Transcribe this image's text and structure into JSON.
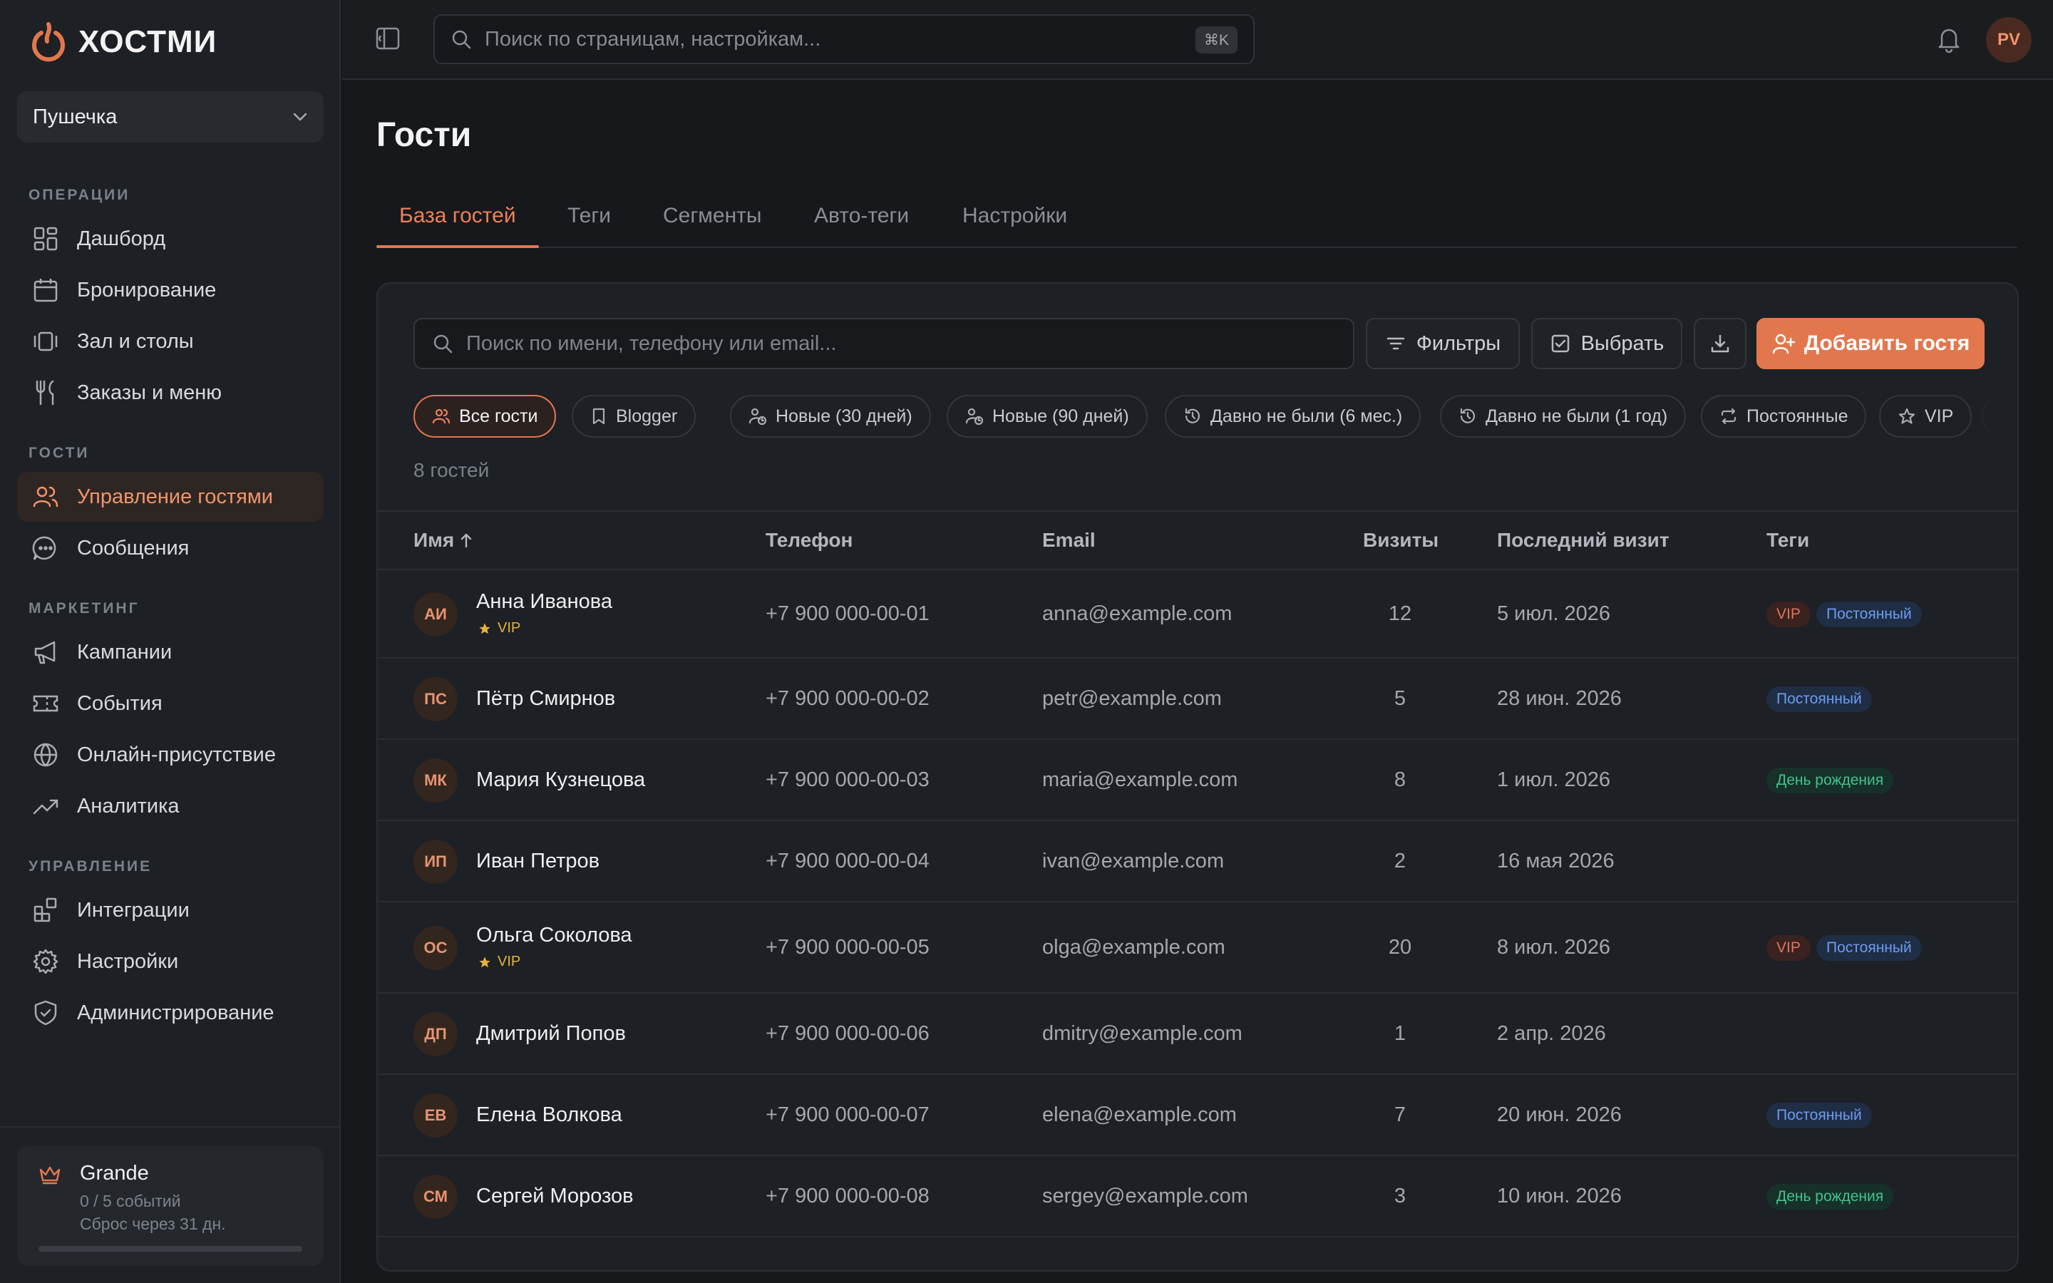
{
  "brand": {
    "logo_text": "ХОСТМИ",
    "accent": "#e2774e"
  },
  "venue": {
    "name": "Пушечка"
  },
  "sidebar": {
    "sections": [
      {
        "title": "ОПЕРАЦИИ",
        "items": [
          {
            "label": "Дашборд",
            "icon": "dashboard-icon"
          },
          {
            "label": "Бронирование",
            "icon": "calendar-icon"
          },
          {
            "label": "Зал и столы",
            "icon": "tables-icon"
          },
          {
            "label": "Заказы и меню",
            "icon": "utensils-icon"
          }
        ]
      },
      {
        "title": "ГОСТИ",
        "items": [
          {
            "label": "Управление гостями",
            "icon": "users-icon",
            "active": true
          },
          {
            "label": "Сообщения",
            "icon": "message-icon"
          }
        ]
      },
      {
        "title": "МАРКЕТИНГ",
        "items": [
          {
            "label": "Кампании",
            "icon": "megaphone-icon"
          },
          {
            "label": "События",
            "icon": "ticket-icon"
          },
          {
            "label": "Онлайн-присутствие",
            "icon": "globe-icon"
          },
          {
            "label": "Аналитика",
            "icon": "trending-icon"
          }
        ]
      },
      {
        "title": "УПРАВЛЕНИЕ",
        "items": [
          {
            "label": "Интеграции",
            "icon": "blocks-icon"
          },
          {
            "label": "Настройки",
            "icon": "gear-icon"
          },
          {
            "label": "Администрирование",
            "icon": "shield-icon"
          }
        ]
      }
    ]
  },
  "plan": {
    "name": "Grande",
    "events": "0 / 5 событий",
    "reset": "Сброс через 31 дн.",
    "progress_fraction": 0.0
  },
  "topbar": {
    "search_placeholder": "Поиск по страницам, настройкам...",
    "shortcut": "⌘K",
    "user_initials": "PV"
  },
  "page": {
    "title": "Гости",
    "tabs": [
      {
        "label": "База гостей",
        "active": true
      },
      {
        "label": "Теги"
      },
      {
        "label": "Сегменты"
      },
      {
        "label": "Авто-теги"
      },
      {
        "label": "Настройки"
      }
    ]
  },
  "toolbar": {
    "search_placeholder": "Поиск по имени, телефону или email...",
    "filters_label": "Фильтры",
    "select_label": "Выбрать",
    "add_label": "Добавить гостя"
  },
  "chips": [
    {
      "label": "Все гости",
      "icon": "users-icon",
      "active": true
    },
    {
      "label": "Blogger",
      "icon": "bookmark-icon"
    },
    {
      "label": "Новые (30 дней)",
      "icon": "user-clock-icon"
    },
    {
      "label": "Новые (90 дней)",
      "icon": "user-clock-icon"
    },
    {
      "label": "Давно не были (6 мес.)",
      "icon": "history-icon"
    },
    {
      "label": "Давно не были (1 год)",
      "icon": "history-icon"
    },
    {
      "label": "Постоянные",
      "icon": "repeat-icon"
    },
    {
      "label": "VIP",
      "icon": "star-icon"
    }
  ],
  "guest_count": "8 гостей",
  "table": {
    "columns": {
      "name": "Имя",
      "phone": "Телефон",
      "email": "Email",
      "visits": "Визиты",
      "last_visit": "Последний визит",
      "tags": "Теги"
    },
    "rows": [
      {
        "initials": "АИ",
        "name": "Анна Иванова",
        "badge": "VIP",
        "phone": "+7 900 000-00-01",
        "email": "anna@example.com",
        "visits": "12",
        "last_visit": "5 июл. 2026",
        "tags": [
          "VIP",
          "Постоянный"
        ]
      },
      {
        "initials": "ПС",
        "name": "Пётр Смирнов",
        "badge": "",
        "phone": "+7 900 000-00-02",
        "email": "petr@example.com",
        "visits": "5",
        "last_visit": "28 июн. 2026",
        "tags": [
          "Постоянный"
        ]
      },
      {
        "initials": "МК",
        "name": "Мария Кузнецова",
        "badge": "",
        "phone": "+7 900 000-00-03",
        "email": "maria@example.com",
        "visits": "8",
        "last_visit": "1 июл. 2026",
        "tags": [
          "День рождения"
        ]
      },
      {
        "initials": "ИП",
        "name": "Иван Петров",
        "badge": "",
        "phone": "+7 900 000-00-04",
        "email": "ivan@example.com",
        "visits": "2",
        "last_visit": "16 мая 2026",
        "tags": []
      },
      {
        "initials": "ОС",
        "name": "Ольга Соколова",
        "badge": "VIP",
        "phone": "+7 900 000-00-05",
        "email": "olga@example.com",
        "visits": "20",
        "last_visit": "8 июл. 2026",
        "tags": [
          "VIP",
          "Постоянный"
        ]
      },
      {
        "initials": "ДП",
        "name": "Дмитрий Попов",
        "badge": "",
        "phone": "+7 900 000-00-06",
        "email": "dmitry@example.com",
        "visits": "1",
        "last_visit": "2 апр. 2026",
        "tags": []
      },
      {
        "initials": "ЕВ",
        "name": "Елена Волкова",
        "badge": "",
        "phone": "+7 900 000-00-07",
        "email": "elena@example.com",
        "visits": "7",
        "last_visit": "20 июн. 2026",
        "tags": [
          "Постоянный"
        ]
      },
      {
        "initials": "СМ",
        "name": "Сергей Морозов",
        "badge": "",
        "phone": "+7 900 000-00-08",
        "email": "sergey@example.com",
        "visits": "3",
        "last_visit": "10 июн. 2026",
        "tags": [
          "День рождения"
        ]
      }
    ]
  }
}
